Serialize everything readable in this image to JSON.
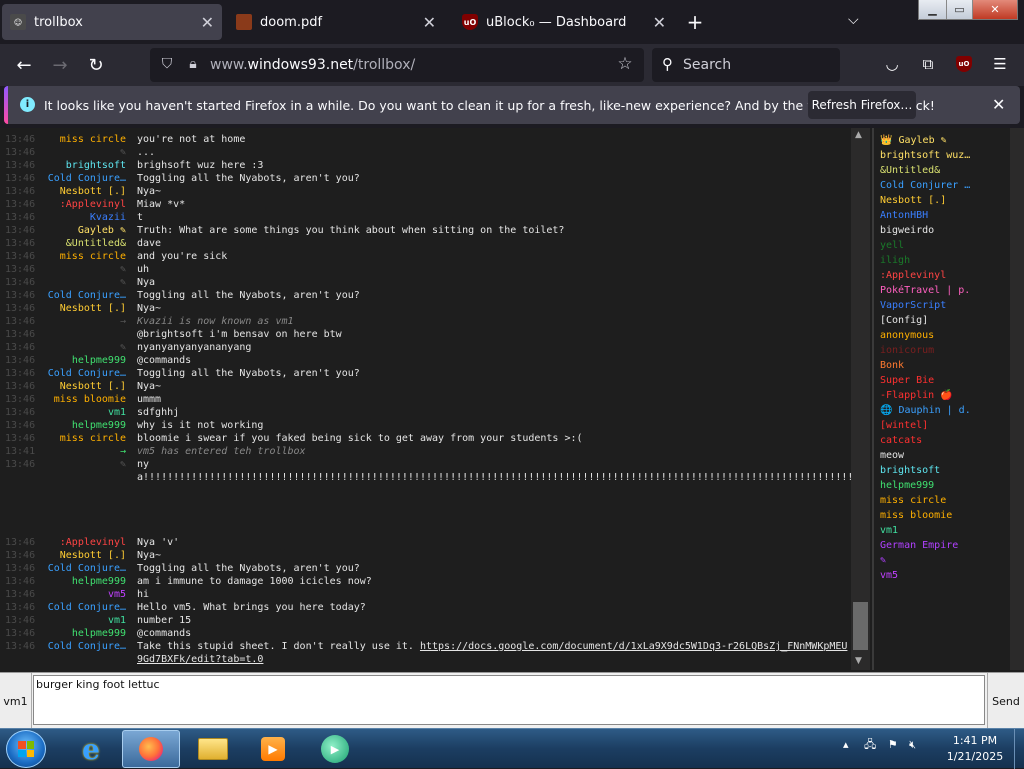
{
  "tabs": [
    {
      "label": "trollbox",
      "icon": "trollbox-icon",
      "active": true
    },
    {
      "label": "doom.pdf",
      "icon": "pdf-doom-icon",
      "active": false
    },
    {
      "label": "uBlock₀ — Dashboard",
      "icon": "ublock-icon",
      "active": false
    }
  ],
  "address": {
    "domain_prefix": "www.",
    "domain": "windows93.net",
    "path": "/trollbox/"
  },
  "search": {
    "placeholder": "Search"
  },
  "notification": {
    "message": "It looks like you haven't started Firefox in a while. Do you want to clean it up for a fresh, like-new experience? And by the way, welcome back!",
    "button": "Refresh Firefox…"
  },
  "chat": {
    "messages": [
      {
        "time": "13:46",
        "nick": "miss circle",
        "color": "#ffb000",
        "text": "you're not at home"
      },
      {
        "time": "13:46",
        "nick": "✎",
        "color": "#555555",
        "text": "..."
      },
      {
        "time": "13:46",
        "nick": "brightsoft",
        "color": "#5ee6f0",
        "text": "brighsoft wuz here :3"
      },
      {
        "time": "13:46",
        "nick": "Cold Conjure…",
        "color": "#3aa0ff",
        "text": "Toggling all the Nyabots, aren't you?"
      },
      {
        "time": "13:46",
        "nick": "Nesbott [.]",
        "color": "#ffcc33",
        "text": "Nya~"
      },
      {
        "time": "13:46",
        "nick": ":Applevinyl",
        "color": "#ff4444",
        "text": "Miaw *v*"
      },
      {
        "time": "13:46",
        "nick": "Kvazii",
        "color": "#3a7fff",
        "text": "t"
      },
      {
        "time": "13:46",
        "nick": "Gayleb ✎",
        "color": "#ffe066",
        "text": "Truth: What are some things you think about when sitting on the toilet?"
      },
      {
        "time": "13:46",
        "nick": "&Untitled&",
        "color": "#d8e070",
        "text": "dave"
      },
      {
        "time": "13:46",
        "nick": "miss circle",
        "color": "#ffb000",
        "text": "and you're sick"
      },
      {
        "time": "13:46",
        "nick": "✎",
        "color": "#555555",
        "text": "uh"
      },
      {
        "time": "13:46",
        "nick": "✎",
        "color": "#555555",
        "text": "Nya"
      },
      {
        "time": "13:46",
        "nick": "Cold Conjure…",
        "color": "#3aa0ff",
        "text": "Toggling all the Nyabots, aren't you?"
      },
      {
        "time": "13:46",
        "nick": "Nesbott [.]",
        "color": "#ffcc33",
        "text": "Nya~"
      },
      {
        "time": "13:46",
        "nick": "→",
        "color": "#555555",
        "text": "Kvazii is now known as vm1",
        "system": true
      },
      {
        "time": "13:46",
        "nick": "",
        "color": "#7a1f1f",
        "text": "@brightsoft i'm bensav on here btw"
      },
      {
        "time": "13:46",
        "nick": "✎",
        "color": "#555555",
        "text": "nyanyanyanyananyang"
      },
      {
        "time": "13:46",
        "nick": "helpme999",
        "color": "#40e070",
        "text": "@commands"
      },
      {
        "time": "13:46",
        "nick": "Cold Conjure…",
        "color": "#3aa0ff",
        "text": "Toggling all the Nyabots, aren't you?"
      },
      {
        "time": "13:46",
        "nick": "Nesbott [.]",
        "color": "#ffcc33",
        "text": "Nya~"
      },
      {
        "time": "13:46",
        "nick": "miss bloomie",
        "color": "#ffb000",
        "text": "ummm"
      },
      {
        "time": "13:46",
        "nick": "vm1",
        "color": "#40e0a0",
        "text": "sdfghhj"
      },
      {
        "time": "13:46",
        "nick": "helpme999",
        "color": "#40e070",
        "text": "why is it not working"
      },
      {
        "time": "13:46",
        "nick": "miss circle",
        "color": "#ffb000",
        "text": "bloomie i swear if you faked being sick to get away from your students >:("
      },
      {
        "time": "13:41",
        "nick": "→",
        "color": "#40e070",
        "text": "vm5 has entered teh trollbox",
        "system": true
      },
      {
        "time": "13:46",
        "nick": "✎",
        "color": "#555555",
        "text": "nya!!!!!!!!!!!!!!!!!!!!!!!!!!!!!!!!!!!!!!!!!!!!!!!!!!!!!!!!!!!!!!!!!!!!!!!!!!!!!!!!!!!!!!!!!!!!!!!!!!!!!!!!!!!!!!!!!!!!!!!!!!!!!!!!!!!!!!!!!!!!!!!!!!!!!!!!!!!!!!!!!!!!!!!!!!!!!!!!!!!!!!!!!!!!!!!!!!!!!!!!!!!!!!!!!!!!!!!!!!!!!!!!!!!!!!!!!!!!!!!!!!!!!!!!!!!!!!!!!!!!!!!!!!!!!!!!!!!!!!!!!!!!!!!!!!!!!!!!!!!!!!!!!!!!!!!!!!!!!!!!!!!!!!!!!!!!!!!!!!!!!!!!!!!!!!!!!!!!!!!!!!!!!!!!!!!!!!!!!!!!!!!!!!!!!!!!!!!!!!!!!!!!!!!!!!!!!!!!!!!!!!!!!!!!!!!!!!!!!!!!!!!!!!!!!!!!!!!!!!!!!!!!!!!!!!!!!!!!!!!!!!!!!!!!!!!!!!!!!!!!!!!!!!!!!!!!!!!!!!!!!!!!!!!!!!!!!!!!!!!!!!!!!!!!!!!!!!!!!!!!!!!!!!!!!!!!!!!!!!!!!!!!!!!!!!!!!"
      },
      {
        "time": "13:46",
        "nick": ":Applevinyl",
        "color": "#ff4444",
        "text": "Nya 'v'"
      },
      {
        "time": "13:46",
        "nick": "Nesbott [.]",
        "color": "#ffcc33",
        "text": "Nya~"
      },
      {
        "time": "13:46",
        "nick": "Cold Conjure…",
        "color": "#3aa0ff",
        "text": "Toggling all the Nyabots, aren't you?"
      },
      {
        "time": "13:46",
        "nick": "helpme999",
        "color": "#40e070",
        "text": "am i immune to damage 1000 icicles now?"
      },
      {
        "time": "13:46",
        "nick": "vm5",
        "color": "#c040ff",
        "text": "hi"
      },
      {
        "time": "13:46",
        "nick": "Cold Conjure…",
        "color": "#3aa0ff",
        "text": "Hello vm5. What brings you here today?"
      },
      {
        "time": "13:46",
        "nick": "vm1",
        "color": "#40e0a0",
        "text": "number 15"
      },
      {
        "time": "13:46",
        "nick": "helpme999",
        "color": "#40e070",
        "text": "@commands"
      },
      {
        "time": "13:46",
        "nick": "Cold Conjure…",
        "color": "#3aa0ff",
        "text": "Take this stupid sheet. I don't really use it. https://docs.google.com/document/d/1xLa9X9dc5W1Dq3-r26LQBsZj_FNnMWKpMEU9Gd7BXFk/edit?tab=t.0"
      }
    ]
  },
  "users": [
    {
      "name": "👑 Gayleb ✎",
      "color": "#ffe066"
    },
    {
      "name": "brightsoft wuz…",
      "color": "#ffe066"
    },
    {
      "name": "&Untitled&",
      "color": "#d8e070"
    },
    {
      "name": "Cold Conjurer …",
      "color": "#3aa0ff"
    },
    {
      "name": "Nesbott [.]",
      "color": "#ffcc33"
    },
    {
      "name": "AntonHBH",
      "color": "#3a7fff"
    },
    {
      "name": "bigweirdo",
      "color": "#e5e5e5"
    },
    {
      "name": "yell",
      "color": "#1a7a2a"
    },
    {
      "name": "iligh",
      "color": "#1a7a2a"
    },
    {
      "name": ":Applevinyl",
      "color": "#ff4444"
    },
    {
      "name": "PokéTravel | p.",
      "color": "#ff60c0"
    },
    {
      "name": "VaporScript",
      "color": "#3a7fff"
    },
    {
      "name": "[Config]",
      "color": "#e5e5e5"
    },
    {
      "name": "anonymous",
      "color": "#ffb000"
    },
    {
      "name": "ionicorum",
      "color": "#7a1f1f"
    },
    {
      "name": "Bonk",
      "color": "#ff7a30"
    },
    {
      "name": "Super Bie",
      "color": "#ff3030"
    },
    {
      "name": "-Flapplin 🍎",
      "color": "#ff3030"
    },
    {
      "name": "🌐 Dauphin | d.",
      "color": "#3aa0ff"
    },
    {
      "name": "[wintel]",
      "color": "#ff3030"
    },
    {
      "name": "catcats",
      "color": "#ff3030"
    },
    {
      "name": "meow",
      "color": "#e5e5e5"
    },
    {
      "name": "brightsoft",
      "color": "#5ee6f0"
    },
    {
      "name": "helpme999",
      "color": "#40e070"
    },
    {
      "name": "miss circle",
      "color": "#ffb000"
    },
    {
      "name": "miss bloomie",
      "color": "#ffb000"
    },
    {
      "name": "vm1",
      "color": "#40e0a0"
    },
    {
      "name": "German Empire",
      "color": "#b040ff"
    },
    {
      "name": "✎",
      "color": "#b040ff"
    },
    {
      "name": "vm5",
      "color": "#c040ff"
    }
  ],
  "input": {
    "nick_button": "vm1",
    "value": "burger king foot lettuc",
    "send_button": "Send"
  },
  "taskbar": {
    "time": "1:41 PM",
    "date": "1/21/2025"
  }
}
